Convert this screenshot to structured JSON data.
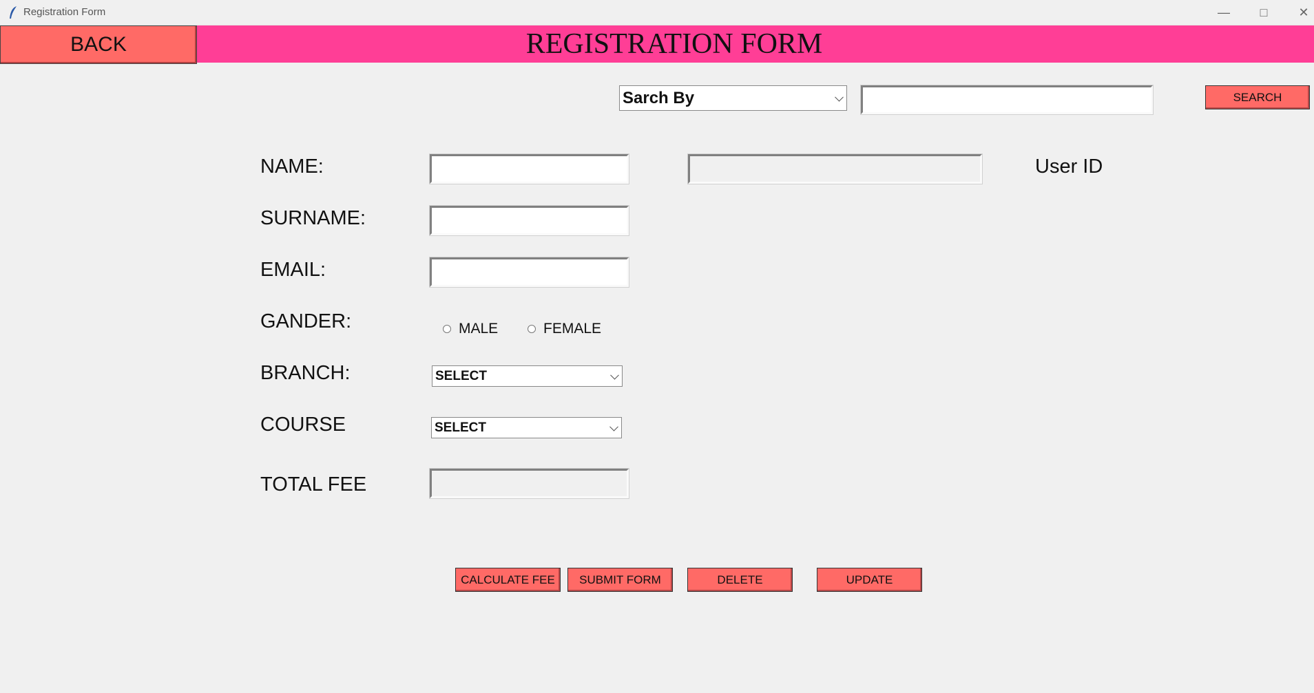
{
  "window": {
    "title": "Registration Form"
  },
  "header": {
    "back_label": "BACK",
    "title": "REGISTRATION FORM"
  },
  "search": {
    "by_value": "Sarch By",
    "query_value": "",
    "button_label": "SEARCH"
  },
  "form": {
    "name_label": "NAME:",
    "surname_label": "SURNAME:",
    "email_label": "EMAIL:",
    "gender_label": "GANDER:",
    "gender_options": [
      "MALE",
      "FEMALE"
    ],
    "branch_label": "BRANCH:",
    "branch_value": "SELECT",
    "course_label": "COURSE",
    "course_value": "SELECT",
    "total_fee_label": "TOTAL FEE",
    "user_id_label": "User ID"
  },
  "actions": {
    "calculate_label": "CALCULATE FEE",
    "submit_label": "SUBMIT FORM",
    "delete_label": "DELETE",
    "update_label": "UPDATE"
  },
  "colors": {
    "header": "#ff3e96",
    "button": "#ff6a66",
    "background": "#f0f0f0"
  }
}
